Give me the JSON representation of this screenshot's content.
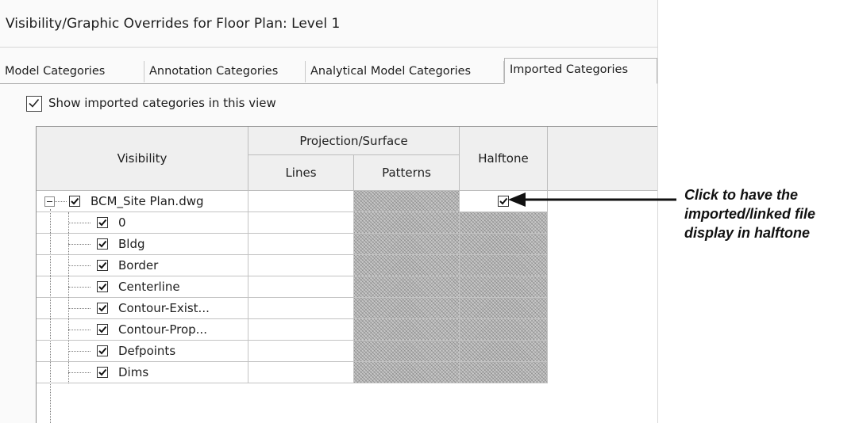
{
  "window": {
    "title": "Visibility/Graphic Overrides for Floor Plan: Level 1"
  },
  "tabs": [
    {
      "label": "Model Categories",
      "active": false
    },
    {
      "label": "Annotation Categories",
      "active": false
    },
    {
      "label": "Analytical Model Categories",
      "active": false
    },
    {
      "label": "Imported Categories",
      "active": true
    }
  ],
  "show_imported": {
    "label": "Show imported categories in this view",
    "checked": true
  },
  "table": {
    "headers": {
      "visibility": "Visibility",
      "projection_surface": "Projection/Surface",
      "lines": "Lines",
      "patterns": "Patterns",
      "halftone": "Halftone"
    },
    "parent": {
      "label": "BCM_Site Plan.dwg",
      "checked": true,
      "halftone": true,
      "expanded": true
    },
    "layers": [
      {
        "label": "0",
        "checked": true
      },
      {
        "label": "Bldg",
        "checked": true
      },
      {
        "label": "Border",
        "checked": true
      },
      {
        "label": "Centerline",
        "checked": true
      },
      {
        "label": "Contour-Exist...",
        "checked": true
      },
      {
        "label": "Contour-Prop...",
        "checked": true
      },
      {
        "label": "Defpoints",
        "checked": true
      },
      {
        "label": "Dims",
        "checked": true
      }
    ]
  },
  "annotation": {
    "lines": [
      "Click to have the",
      "imported/linked file",
      "display in halftone"
    ]
  }
}
